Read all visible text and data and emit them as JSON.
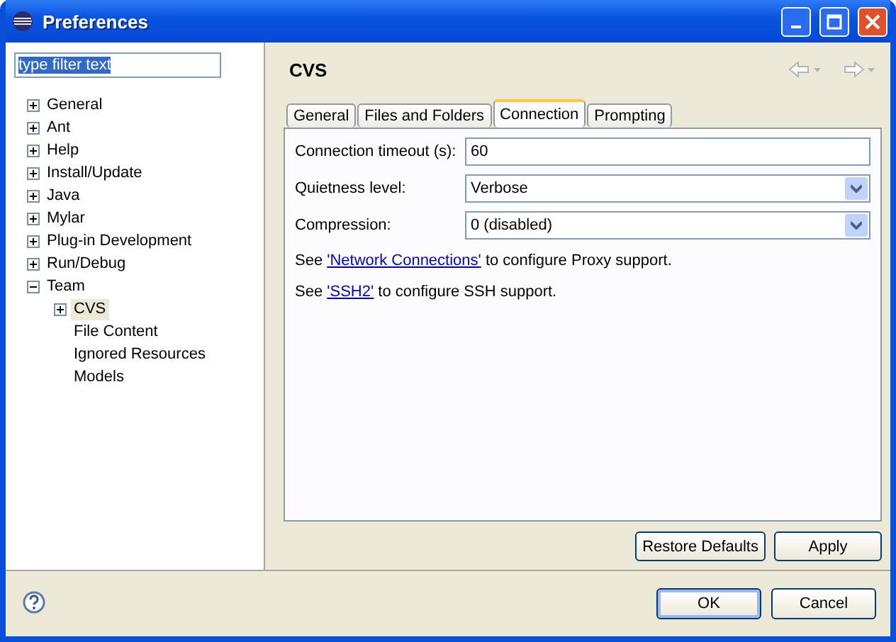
{
  "window": {
    "title": "Preferences"
  },
  "filter": {
    "value": "type filter text",
    "text_selected": true
  },
  "tree": [
    {
      "label": "General",
      "expanded": false,
      "selected": false,
      "has_children": true
    },
    {
      "label": "Ant",
      "expanded": false,
      "selected": false,
      "has_children": true
    },
    {
      "label": "Help",
      "expanded": false,
      "selected": false,
      "has_children": true
    },
    {
      "label": "Install/Update",
      "expanded": false,
      "selected": false,
      "has_children": true
    },
    {
      "label": "Java",
      "expanded": false,
      "selected": false,
      "has_children": true
    },
    {
      "label": "Mylar",
      "expanded": false,
      "selected": false,
      "has_children": true
    },
    {
      "label": "Plug-in Development",
      "expanded": false,
      "selected": false,
      "has_children": true
    },
    {
      "label": "Run/Debug",
      "expanded": false,
      "selected": false,
      "has_children": true
    },
    {
      "label": "Team",
      "expanded": true,
      "selected": false,
      "has_children": true,
      "children": [
        {
          "label": "CVS",
          "expanded": false,
          "selected": true,
          "has_children": true
        },
        {
          "label": "File Content",
          "selected": false
        },
        {
          "label": "Ignored Resources",
          "selected": false
        },
        {
          "label": "Models",
          "selected": false
        }
      ]
    }
  ],
  "page": {
    "title": "CVS",
    "nav_disabled": true
  },
  "tabs": [
    {
      "label": "General",
      "selected": false
    },
    {
      "label": "Files and Folders",
      "selected": false
    },
    {
      "label": "Connection",
      "selected": true
    },
    {
      "label": "Prompting",
      "selected": false
    }
  ],
  "fields": [
    {
      "kind": "text",
      "label": "Connection timeout (s):",
      "value": "60"
    },
    {
      "kind": "combo",
      "label": "Quietness level:",
      "value": "Verbose"
    },
    {
      "kind": "combo",
      "label": "Compression:",
      "value": "0 (disabled)"
    }
  ],
  "notes": [
    {
      "prefix": "See ",
      "link": "'Network Connections'",
      "suffix": " to configure Proxy support."
    },
    {
      "prefix": "See ",
      "link": "'SSH2'",
      "suffix": " to configure SSH support."
    }
  ],
  "page_buttons": [
    "Restore Defaults",
    "Apply"
  ],
  "dialog_buttons": [
    {
      "label": "OK",
      "default": true
    },
    {
      "label": "Cancel",
      "default": false
    }
  ]
}
